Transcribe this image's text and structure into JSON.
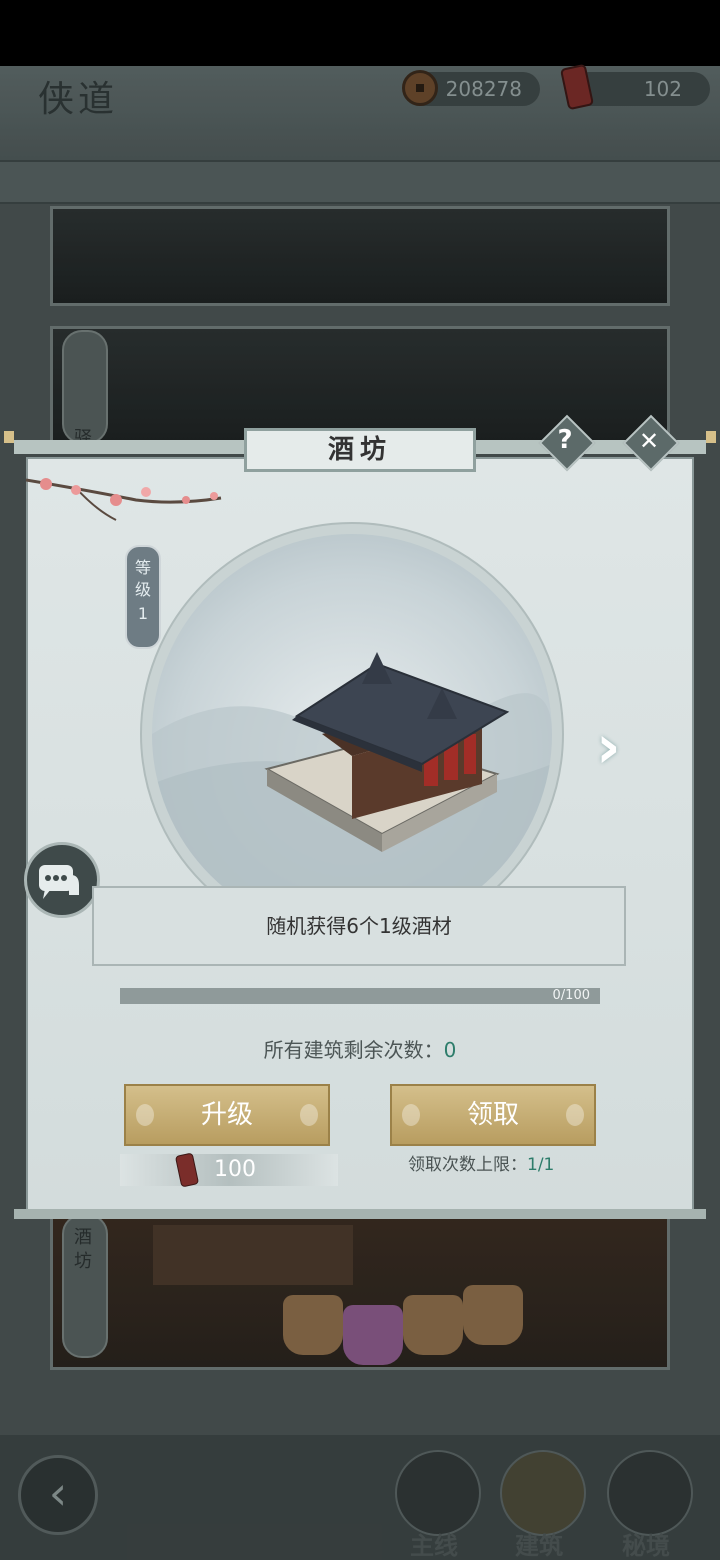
{
  "header": {
    "logo": "侠道",
    "coins": "208278",
    "tokens": "102"
  },
  "background": {
    "side_tab_top": "驿",
    "side_tab_bottom": "酒坊"
  },
  "nav": {
    "items": [
      {
        "label": "主线"
      },
      {
        "label": "建筑"
      },
      {
        "label": "秘境"
      }
    ]
  },
  "dialog": {
    "title": "酒坊",
    "help_glyph": "?",
    "close_glyph": "✕",
    "level_label": "等级",
    "level_value": "1",
    "description": "随机获得6个1级酒材",
    "progress_text": "0/100",
    "progress_fraction": 0,
    "remaining_label": "所有建筑剩余次数：",
    "remaining_value": "0",
    "upgrade_label": "升级",
    "upgrade_cost": "100",
    "claim_label": "领取",
    "claim_limit_label": "领取次数上限：",
    "claim_limit_value": "1/1"
  },
  "colors": {
    "accent_gold": "#c9b07a",
    "highlight_green": "#2e7d6b",
    "panel": "#dfe6e6"
  }
}
